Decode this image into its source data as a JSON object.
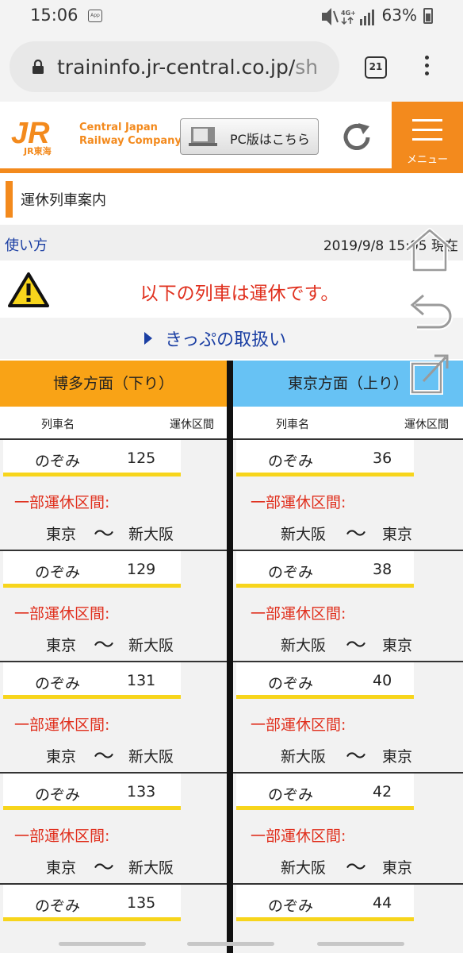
{
  "status_bar": {
    "time": "15:06",
    "app_badge": "App",
    "network": "4G+",
    "battery": "63%"
  },
  "browser": {
    "url_main": "traininfo.jr-central.co.jp/",
    "url_dim": "sh",
    "tab_count": "21"
  },
  "header": {
    "logo_text": "JR",
    "logo_sub": "JR東海",
    "company_line1": "Central Japan",
    "company_line2": "Railway Company",
    "pc_button": "PC版はこちら",
    "menu_label": "メニュー"
  },
  "page": {
    "title": "運休列車案内",
    "howto_link": "使い方",
    "timestamp": "2019/9/8 15:05 現在",
    "warning": "以下の列車は運休です。",
    "ticket_link": "きっぷの取扱い"
  },
  "directions": {
    "left": {
      "title": "博多方面（下り）",
      "col_name": "列車名",
      "col_section": "運休区間"
    },
    "right": {
      "title": "東京方面（上り）",
      "col_name": "列車名",
      "col_section": "運休区間"
    }
  },
  "trains_down": [
    {
      "name": "のぞみ",
      "number": "125",
      "status": "一部運休区間:",
      "from": "東京",
      "sep": "〜",
      "to": "新大阪"
    },
    {
      "name": "のぞみ",
      "number": "129",
      "status": "一部運休区間:",
      "from": "東京",
      "sep": "〜",
      "to": "新大阪"
    },
    {
      "name": "のぞみ",
      "number": "131",
      "status": "一部運休区間:",
      "from": "東京",
      "sep": "〜",
      "to": "新大阪"
    },
    {
      "name": "のぞみ",
      "number": "133",
      "status": "一部運休区間:",
      "from": "東京",
      "sep": "〜",
      "to": "新大阪"
    },
    {
      "name": "のぞみ",
      "number": "135",
      "status": "",
      "from": "",
      "sep": "",
      "to": ""
    }
  ],
  "trains_up": [
    {
      "name": "のぞみ",
      "number": "36",
      "status": "一部運休区間:",
      "from": "新大阪",
      "sep": "〜",
      "to": "東京"
    },
    {
      "name": "のぞみ",
      "number": "38",
      "status": "一部運休区間:",
      "from": "新大阪",
      "sep": "〜",
      "to": "東京"
    },
    {
      "name": "のぞみ",
      "number": "40",
      "status": "一部運休区間:",
      "from": "新大阪",
      "sep": "〜",
      "to": "東京"
    },
    {
      "name": "のぞみ",
      "number": "42",
      "status": "一部運休区間:",
      "from": "新大阪",
      "sep": "〜",
      "to": "東京"
    },
    {
      "name": "のぞみ",
      "number": "44",
      "status": "",
      "from": "",
      "sep": "",
      "to": ""
    }
  ],
  "colors": {
    "brand_orange": "#f38a1d",
    "down_header": "#f9a316",
    "up_header": "#67c2f4",
    "warning_red": "#e0301e",
    "link_blue": "#1b3fa3",
    "name_underline": "#f7d51c"
  },
  "icons": {
    "lock": "lock-icon",
    "tabs": "tabs-icon",
    "kebab": "more-vert-icon",
    "pc": "monitor-icon",
    "reload": "reload-icon",
    "menu": "hamburger-icon",
    "warning": "warning-icon",
    "home": "home-icon",
    "back": "back-icon",
    "share": "share-icon"
  }
}
